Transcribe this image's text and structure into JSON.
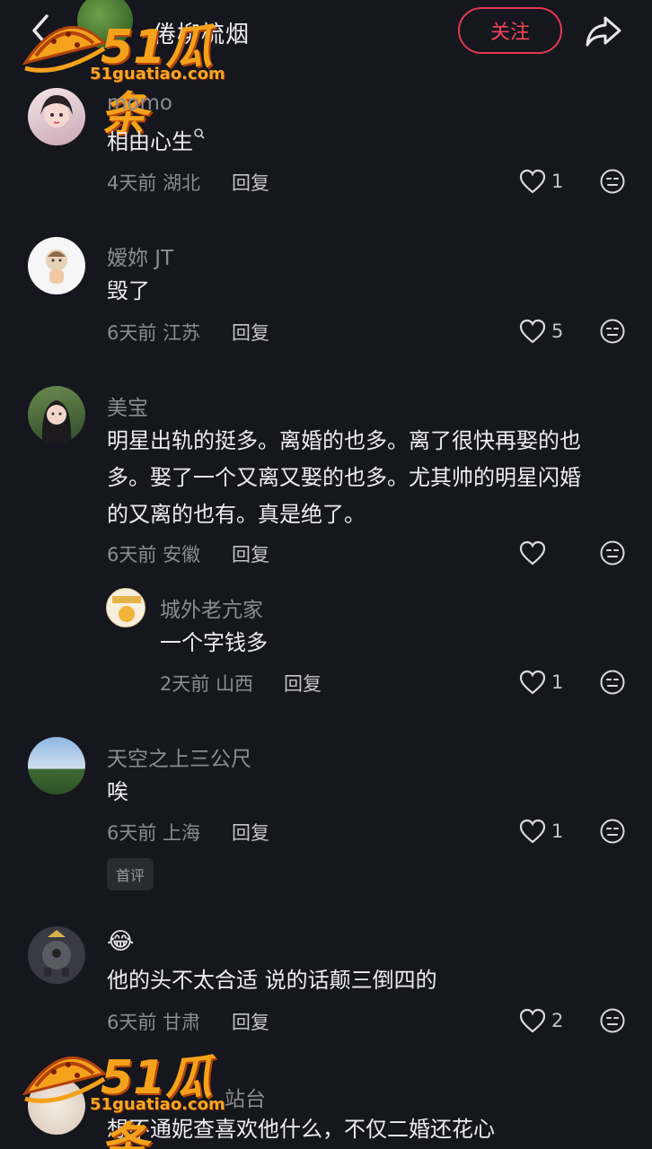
{
  "header": {
    "title": "倦柳梳烟",
    "follow_label": "关注",
    "accent_color": "#e23a4e"
  },
  "watermark": {
    "logo_text": "51瓜条",
    "url": "51guatiao.com"
  },
  "comments": [
    {
      "username": "momo",
      "content": "相由心生",
      "time": "4天前",
      "location": "湖北",
      "reply_label": "回复",
      "likes": "1"
    },
    {
      "username": "嫒妳 JT",
      "content": "毁了",
      "time": "6天前",
      "location": "江苏",
      "reply_label": "回复",
      "likes": "5"
    },
    {
      "username": "美宝",
      "content_lines": [
        "明星出轨的挺多。离婚的也多。离了很快再娶的也",
        "多。娶了一个又离又娶的也多。尤其帅的明星闪婚",
        "的又离的也有。真是绝了。"
      ],
      "time": "6天前",
      "location": "安徽",
      "reply_label": "回复",
      "likes": ""
    },
    {
      "username": "城外老亢家",
      "content": "一个字钱多",
      "time": "2天前",
      "location": "山西",
      "reply_label": "回复",
      "likes": "1"
    },
    {
      "username": "天空之上三公尺",
      "content": "唉",
      "time": "6天前",
      "location": "上海",
      "reply_label": "回复",
      "likes": "1",
      "badge": "首评"
    },
    {
      "username": "😂",
      "content": "他的头不太合适 说的话颠三倒四的",
      "time": "6天前",
      "location": "甘肃",
      "reply_label": "回复",
      "likes": "2"
    },
    {
      "username": "站台",
      "content": "想不通妮查喜欢他什么，不仅二婚还花心"
    }
  ]
}
